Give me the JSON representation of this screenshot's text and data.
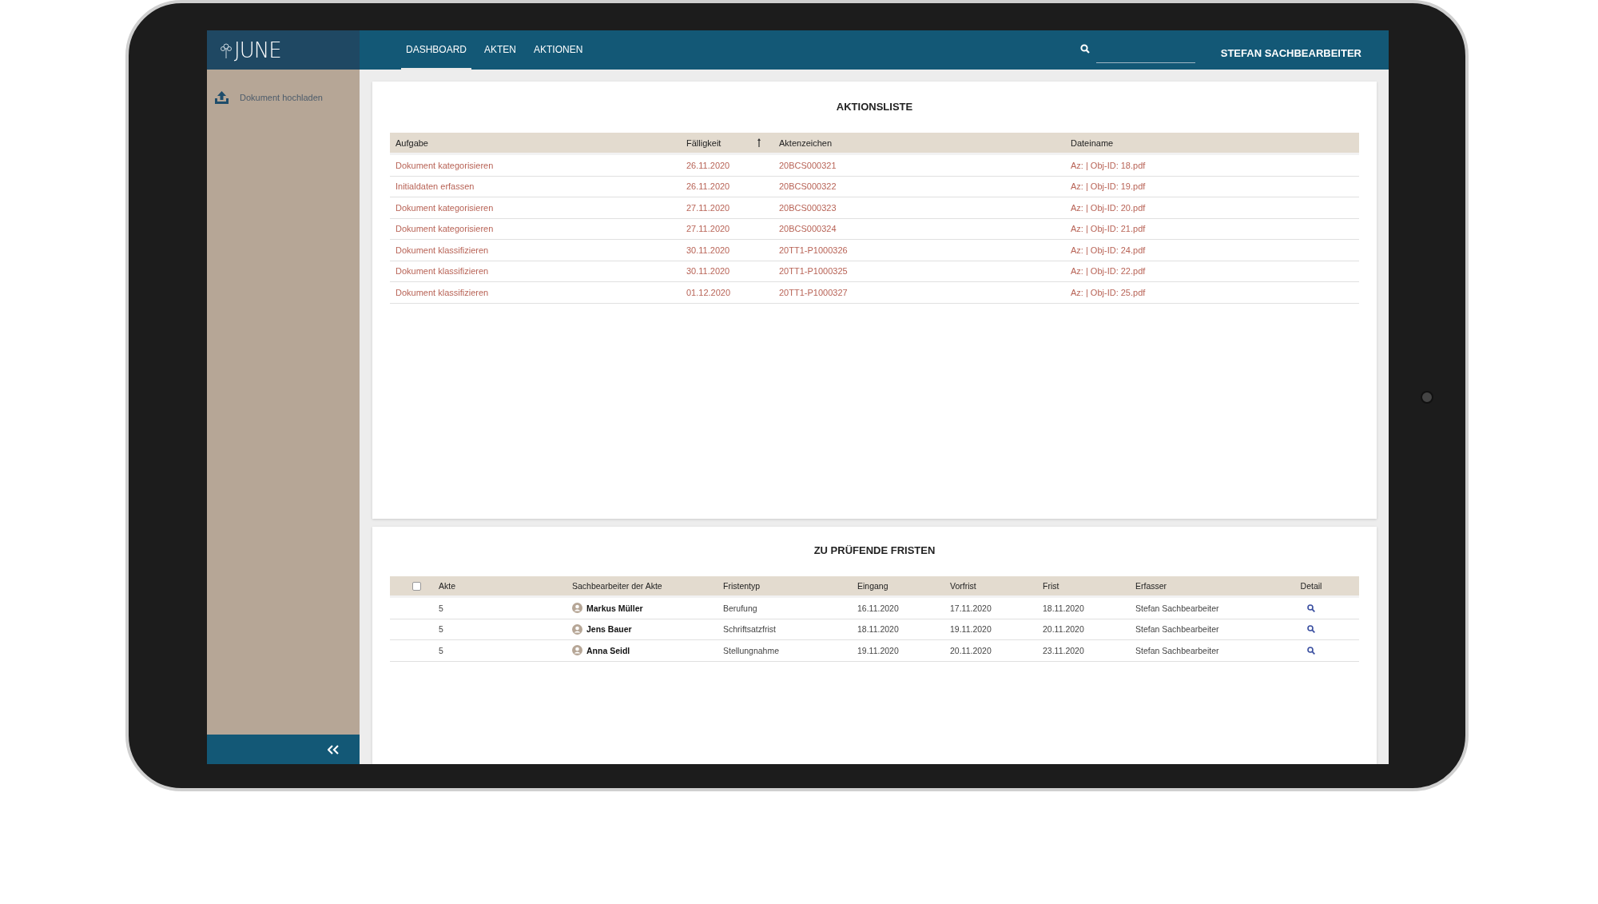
{
  "header": {
    "logo": "JUNE",
    "tabs": [
      {
        "label": "DASHBOARD",
        "selected": true
      },
      {
        "label": "AKTEN",
        "selected": false
      },
      {
        "label": "AKTIONEN",
        "selected": false
      }
    ],
    "user": "STEFAN SACHBEARBEITER"
  },
  "sidebar": {
    "items": [
      {
        "label": "Dokument hochladen"
      }
    ]
  },
  "aktionsliste": {
    "title": "AKTIONSLISTE",
    "columns": [
      {
        "label": "Aufgabe",
        "sorted": false
      },
      {
        "label": "Fälligkeit",
        "sorted": true
      },
      {
        "label": "Aktenzeichen",
        "sorted": false
      },
      {
        "label": "Dateiname",
        "sorted": false
      }
    ],
    "rows": [
      [
        "Dokument kategorisieren",
        "26.11.2020",
        "20BCS000321",
        "Az: | Obj-ID: 18.pdf"
      ],
      [
        "Initialdaten erfassen",
        "26.11.2020",
        "20BCS000322",
        "Az: | Obj-ID: 19.pdf"
      ],
      [
        "Dokument kategorisieren",
        "27.11.2020",
        "20BCS000323",
        "Az: | Obj-ID: 20.pdf"
      ],
      [
        "Dokument kategorisieren",
        "27.11.2020",
        "20BCS000324",
        "Az: | Obj-ID: 21.pdf"
      ],
      [
        "Dokument klassifizieren",
        "30.11.2020",
        "20TT1-P1000326",
        "Az: | Obj-ID: 24.pdf"
      ],
      [
        "Dokument klassifizieren",
        "30.11.2020",
        "20TT1-P1000325",
        "Az: | Obj-ID: 22.pdf"
      ],
      [
        "Dokument klassifizieren",
        "01.12.2020",
        "20TT1-P1000327",
        "Az: | Obj-ID: 25.pdf"
      ]
    ]
  },
  "fristen": {
    "title": "ZU PRÜFENDE FRISTEN",
    "select_all": {
      "checked": false
    },
    "columns": [
      "Akte",
      "Sachbearbeiter der Akte",
      "Fristentyp",
      "Eingang",
      "Vorfrist",
      "Frist",
      "Erfasser",
      "Detail"
    ],
    "rows": [
      {
        "akte": "5",
        "sachbearbeiter": "Markus Müller",
        "fristentyp": "Berufung",
        "eingang": "16.11.2020",
        "vorfrist": "17.11.2020",
        "frist": "18.11.2020",
        "erfasser": "Stefan Sachbearbeiter"
      },
      {
        "akte": "5",
        "sachbearbeiter": "Jens Bauer",
        "fristentyp": "Schriftsatzfrist",
        "eingang": "18.11.2020",
        "vorfrist": "19.11.2020",
        "frist": "20.11.2020",
        "erfasser": "Stefan Sachbearbeiter"
      },
      {
        "akte": "5",
        "sachbearbeiter": "Anna Seidl",
        "fristentyp": "Stellungnahme",
        "eingang": "19.11.2020",
        "vorfrist": "20.11.2020",
        "frist": "23.11.2020",
        "erfasser": "Stefan Sachbearbeiter"
      }
    ]
  }
}
